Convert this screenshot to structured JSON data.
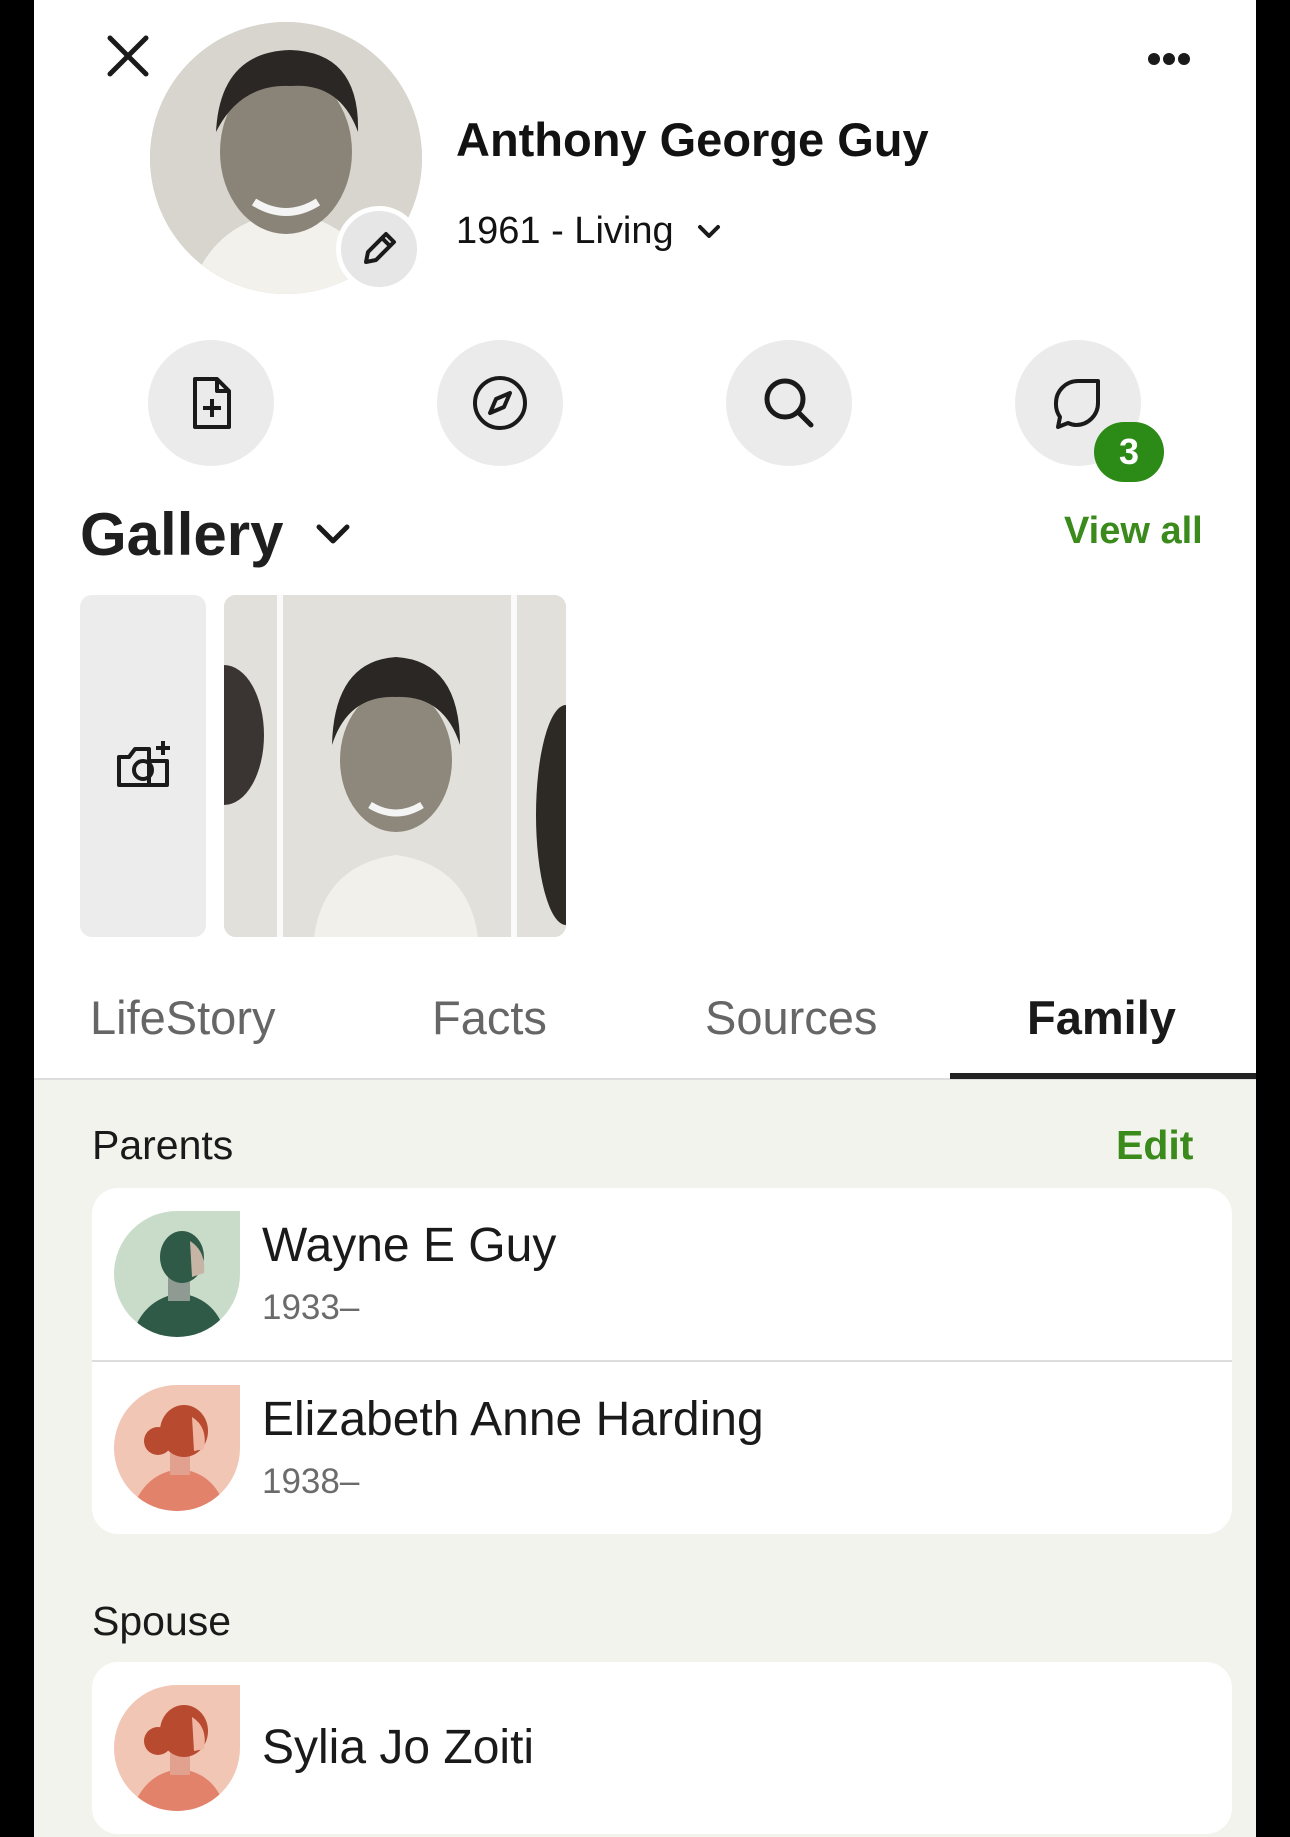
{
  "header": {
    "name": "Anthony George Guy",
    "life_dates": "1961 - Living",
    "close_icon": "close-icon",
    "more_icon": "more-options-icon"
  },
  "actions": {
    "items": [
      "add-document-icon",
      "compass-icon",
      "search-icon",
      "comments-icon"
    ],
    "comments_badge": "3"
  },
  "gallery": {
    "title": "Gallery",
    "view_all_label": "View all"
  },
  "tabs": [
    {
      "label": "LifeStory",
      "active": false
    },
    {
      "label": "Facts",
      "active": false
    },
    {
      "label": "Sources",
      "active": false
    },
    {
      "label": "Family",
      "active": true
    }
  ],
  "family": {
    "parents_label": "Parents",
    "edit_label": "Edit",
    "parents": [
      {
        "name": "Wayne E Guy",
        "dates": "1933–",
        "gender": "male"
      },
      {
        "name": "Elizabeth Anne Harding",
        "dates": "1938–",
        "gender": "female"
      }
    ],
    "spouse_label": "Spouse",
    "spouse": {
      "name": "Sylia Jo Zoiti",
      "gender": "female"
    }
  },
  "colors": {
    "accent_green": "#3a8a1c",
    "badge_green": "#2c8a16",
    "family_bg": "#f3f3ed"
  }
}
